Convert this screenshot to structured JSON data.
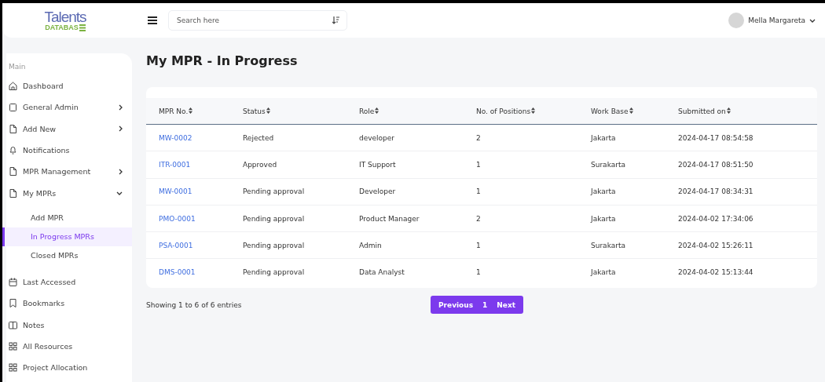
{
  "header": {
    "logo": {
      "top": "Talents",
      "bottom": "DATABAS"
    },
    "search": {
      "placeholder": "Search here"
    },
    "user": {
      "name": "Mella Margareta"
    }
  },
  "sidebar": {
    "section": "Main",
    "items": [
      {
        "label": "Dashboard"
      },
      {
        "label": "General Admin",
        "expanded": false
      },
      {
        "label": "Add New",
        "expanded": false
      },
      {
        "label": "Notifications"
      },
      {
        "label": "MPR Management",
        "expanded": false
      },
      {
        "label": "My MPRs",
        "expanded": true,
        "children": [
          {
            "label": "Add MPR",
            "selected": false
          },
          {
            "label": "In Progress MPRs",
            "selected": true
          },
          {
            "label": "Closed MPRs",
            "selected": false
          }
        ]
      },
      {
        "label": "Last Accessed"
      },
      {
        "label": "Bookmarks"
      },
      {
        "label": "Notes"
      },
      {
        "label": "All Resources"
      },
      {
        "label": "Project Allocation"
      }
    ]
  },
  "page": {
    "title": "My MPR - In Progress"
  },
  "table": {
    "columns": [
      "MPR No.",
      "Status",
      "Role",
      "No. of Positions",
      "Work Base",
      "Submitted on"
    ],
    "rows": [
      [
        "MW-0002",
        "Rejected",
        "developer",
        "2",
        "Jakarta",
        "2024-04-17 08:54:58"
      ],
      [
        "ITR-0001",
        "Approved",
        "IT Support",
        "1",
        "Surakarta",
        "2024-04-17 08:51:50"
      ],
      [
        "MW-0001",
        "Pending approval",
        "Developer",
        "1",
        "Jakarta",
        "2024-04-17 08:34:31"
      ],
      [
        "PMO-0001",
        "Pending approval",
        "Product Manager",
        "2",
        "Jakarta",
        "2024-04-02 17:34:06"
      ],
      [
        "PSA-0001",
        "Pending approval",
        "Admin",
        "1",
        "Surakarta",
        "2024-04-02 15:26:11"
      ],
      [
        "DMS-0001",
        "Pending approval",
        "Data Analyst",
        "1",
        "Jakarta",
        "2024-04-02 15:13:44"
      ]
    ]
  },
  "footer": {
    "info": "Showing 1 to 6 of 6 entries",
    "pagination": {
      "previous": "Previous",
      "pages": [
        {
          "label": "1",
          "selected": true
        }
      ],
      "next": "Next"
    }
  }
}
